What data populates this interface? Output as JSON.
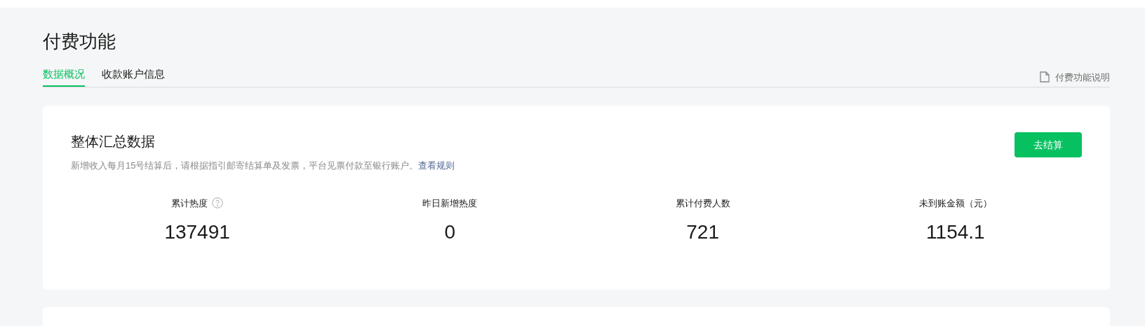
{
  "page_title": "付费功能",
  "tabs": [
    {
      "label": "数据概况",
      "selected": true
    },
    {
      "label": "收款账户信息",
      "selected": false
    }
  ],
  "help_link": {
    "label": "付费功能说明"
  },
  "summary": {
    "title": "整体汇总数据",
    "description": "新增收入每月15号结算后，请根据指引邮寄结算单及发票，平台见票付款至银行账户。",
    "rules_link": "查看规则",
    "button": "去结算",
    "stats": [
      {
        "label": "累计热度",
        "value": "137491",
        "help": true
      },
      {
        "label": "昨日新增热度",
        "value": "0",
        "help": false
      },
      {
        "label": "累计付费人数",
        "value": "721",
        "help": false
      },
      {
        "label": "未到账金额（元）",
        "value": "1154.1",
        "help": false
      }
    ]
  }
}
